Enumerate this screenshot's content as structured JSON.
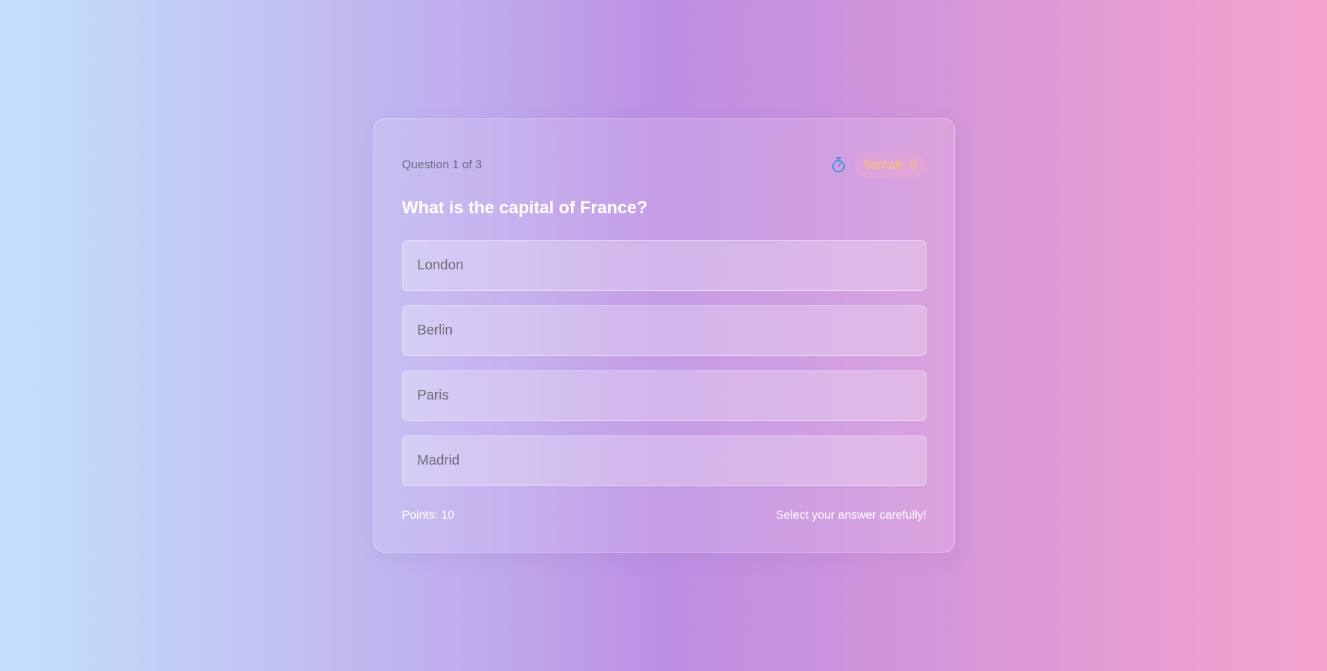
{
  "quiz": {
    "progress": "Question 1 of 3",
    "timer_icon": "stopwatch-icon",
    "streak": "Streak: 0",
    "question": "What is the capital of France?",
    "options": [
      "London",
      "Berlin",
      "Paris",
      "Madrid"
    ],
    "points": "Points: 10",
    "hint": "Select your answer carefully!"
  },
  "colors": {
    "timer_icon": "#4a90e2",
    "streak_text": "#f2b98a",
    "question_text": "#ffffff"
  }
}
